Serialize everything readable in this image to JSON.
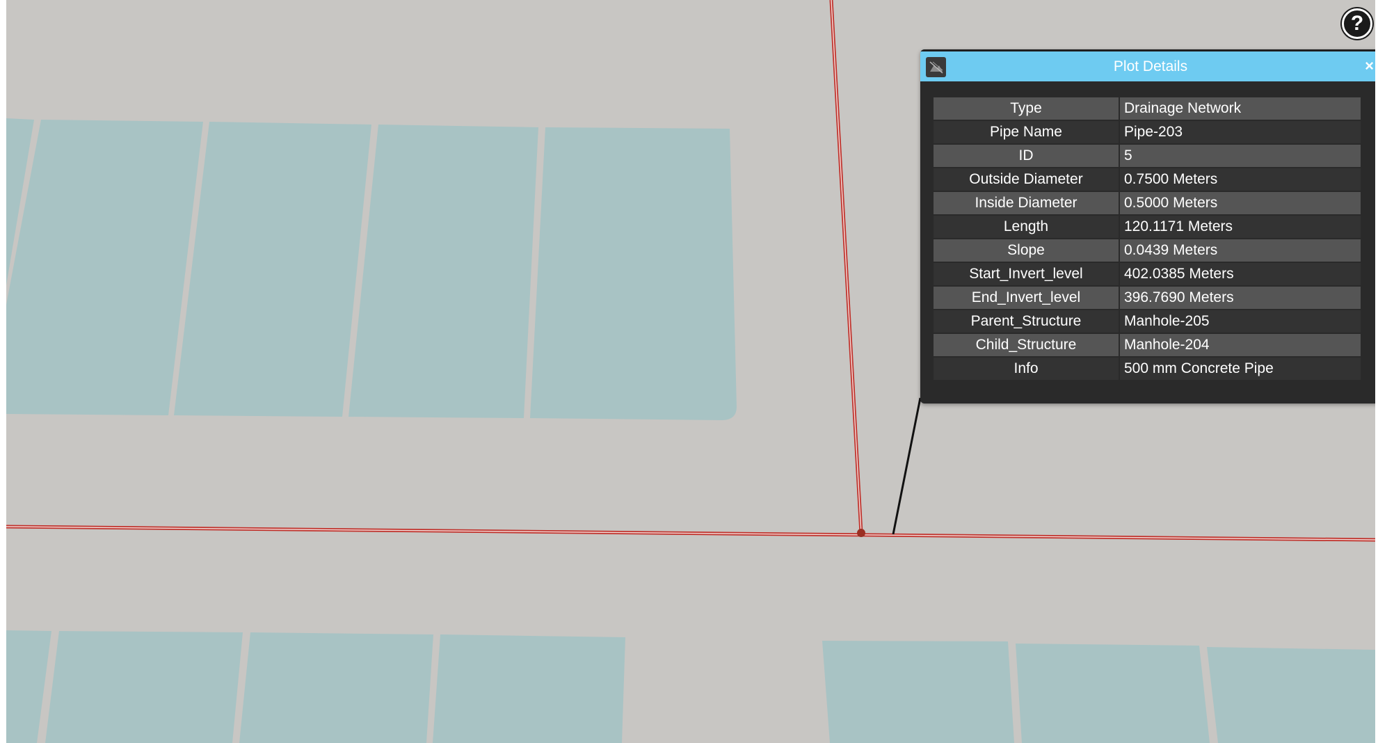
{
  "map": {
    "background_color": "#c8c6c3",
    "lot_color": "#a8c3c4",
    "pipe_color": "#c0322c",
    "node_color": "#9b2f22",
    "leader_color": "#111111"
  },
  "help_button": {
    "label": "?",
    "icon": "question-mark-icon"
  },
  "panel": {
    "title": "Plot Details",
    "close_label": "×",
    "header_color": "#6ecbf1",
    "icon": "map-layer-icon",
    "rows": [
      {
        "key": "Type",
        "value": "Drainage Network"
      },
      {
        "key": "Pipe Name",
        "value": "Pipe-203"
      },
      {
        "key": "ID",
        "value": "5"
      },
      {
        "key": "Outside Diameter",
        "value": "0.7500 Meters"
      },
      {
        "key": "Inside Diameter",
        "value": "0.5000 Meters"
      },
      {
        "key": "Length",
        "value": "120.1171 Meters"
      },
      {
        "key": "Slope",
        "value": "0.0439 Meters"
      },
      {
        "key": "Start_Invert_level",
        "value": "402.0385 Meters"
      },
      {
        "key": "End_Invert_level",
        "value": "396.7690 Meters"
      },
      {
        "key": "Parent_Structure",
        "value": "Manhole-205"
      },
      {
        "key": "Child_Structure",
        "value": "Manhole-204"
      },
      {
        "key": "Info",
        "value": "500 mm Concrete Pipe"
      }
    ]
  }
}
